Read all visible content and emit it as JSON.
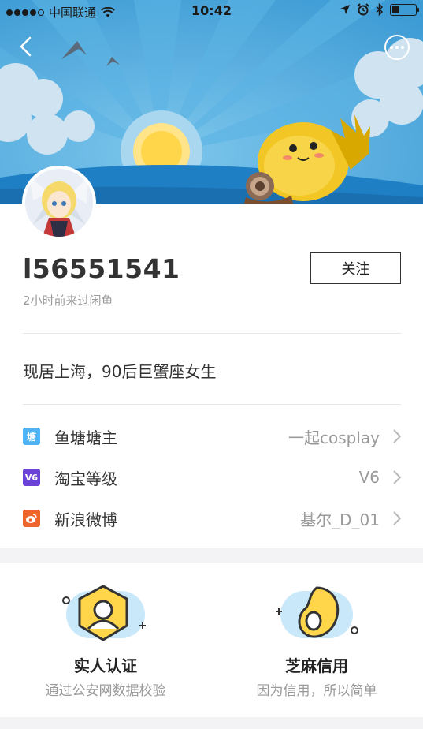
{
  "status_bar": {
    "carrier": "中国联通",
    "time": "10:42",
    "battery_level": 0.3
  },
  "nav": {
    "back_icon": "chevron-left-icon",
    "more_icon": "more-dots-icon"
  },
  "profile": {
    "username": "l56551541",
    "last_seen": "2小时前来过闲鱼",
    "follow_label": "关注",
    "bio": "现居上海，90后巨蟹座女生"
  },
  "info_rows": [
    {
      "icon_text": "塘",
      "icon_color": "#4fb3f3",
      "label": "鱼塘塘主",
      "value": "一起cosplay"
    },
    {
      "icon_text": "V6",
      "icon_color": "#6a42d8",
      "label": "淘宝等级",
      "value": "V6"
    },
    {
      "icon_text": "微",
      "icon_color": "#f0642e",
      "label": "新浪微博",
      "value": "基尔_D_01"
    }
  ],
  "verification": {
    "realname": {
      "title": "实人认证",
      "subtitle": "通过公安网数据校验"
    },
    "zhima": {
      "title": "芝麻信用",
      "subtitle": "因为信用，所以简单"
    }
  },
  "colors": {
    "sky": "#4aa8dc",
    "accent_yellow": "#ffd64a",
    "divider": "#e6e6e6"
  }
}
